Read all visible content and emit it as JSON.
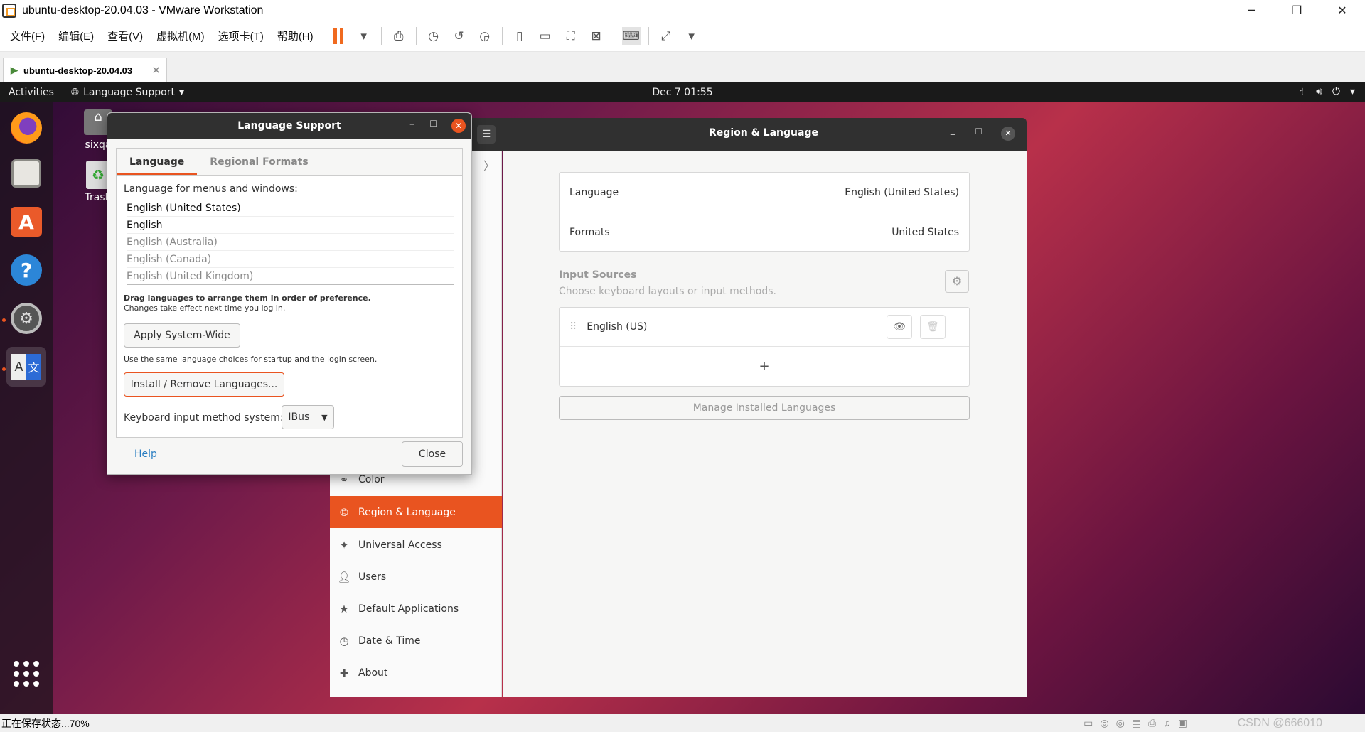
{
  "vm": {
    "title": "ubuntu-desktop-20.04.03 - VMware Workstation",
    "menu": [
      "文件(F)",
      "编辑(E)",
      "查看(V)",
      "虚拟机(M)",
      "选项卡(T)",
      "帮助(H)"
    ],
    "tab_label": "ubuntu-desktop-20.04.03",
    "status_text": "正在保存状态...70%",
    "watermark": "CSDN @666010"
  },
  "topbar": {
    "activities": "Activities",
    "app_menu": "Language Support",
    "clock": "Dec 7  01:55"
  },
  "desktop": {
    "home_label": "sixqa",
    "trash_label": "Trash"
  },
  "settings": {
    "title": "Region & Language",
    "sidebar": [
      {
        "label": "Color",
        "icon": "color-icon"
      },
      {
        "label": "Region & Language",
        "icon": "globe-icon",
        "active": true
      },
      {
        "label": "Universal Access",
        "icon": "accessibility-icon"
      },
      {
        "label": "Users",
        "icon": "users-icon"
      },
      {
        "label": "Default Applications",
        "icon": "star-icon"
      },
      {
        "label": "Date & Time",
        "icon": "clock-icon"
      },
      {
        "label": "About",
        "icon": "about-icon"
      }
    ],
    "language_label": "Language",
    "language_value": "English (United States)",
    "formats_label": "Formats",
    "formats_value": "United States",
    "input_sources_title": "Input Sources",
    "input_sources_subtitle": "Choose keyboard layouts or input methods.",
    "input_source": "English (US)",
    "add": "+",
    "manage_button": "Manage Installed Languages"
  },
  "dialog": {
    "title": "Language Support",
    "tab_language": "Language",
    "tab_formats": "Regional Formats",
    "menus_label": "Language for menus and windows:",
    "languages": [
      {
        "name": "English (United States)",
        "active": true
      },
      {
        "name": "English",
        "active": true
      },
      {
        "name": "English (Australia)",
        "active": false
      },
      {
        "name": "English (Canada)",
        "active": false
      },
      {
        "name": "English (United Kingdom)",
        "active": false
      }
    ],
    "drag_hint": "Drag languages to arrange them in order of preference.",
    "changes_hint": "Changes take effect next time you log in.",
    "apply_button": "Apply System-Wide",
    "apply_hint": "Use the same language choices for startup and the login screen.",
    "install_button": "Install / Remove Languages...",
    "keyboard_label": "Keyboard input method system:",
    "keyboard_value": "IBus",
    "help": "Help",
    "close": "Close"
  }
}
